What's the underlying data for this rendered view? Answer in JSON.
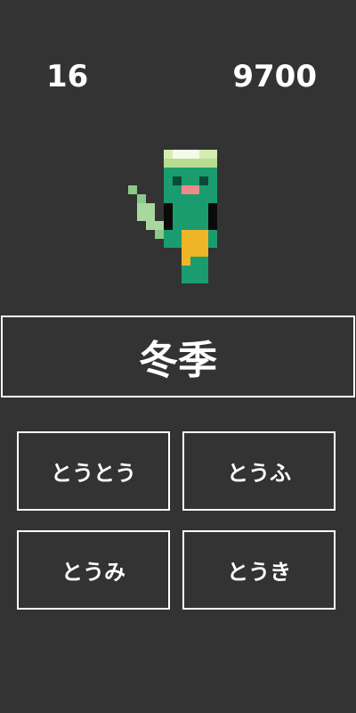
{
  "hud": {
    "count": "16",
    "score": "9700"
  },
  "character": {
    "icon": "green-dinosaur-character-pixel-art"
  },
  "question": {
    "kanji": "冬季"
  },
  "choices": [
    {
      "label": "とうとう"
    },
    {
      "label": "とうふ"
    },
    {
      "label": "とうみ"
    },
    {
      "label": "とうき"
    }
  ],
  "colors": {
    "background": "#333333",
    "text": "#ffffff",
    "body_green": "#1a9c6e",
    "hat": "#c8e6a0",
    "apron": "#f0b428"
  }
}
